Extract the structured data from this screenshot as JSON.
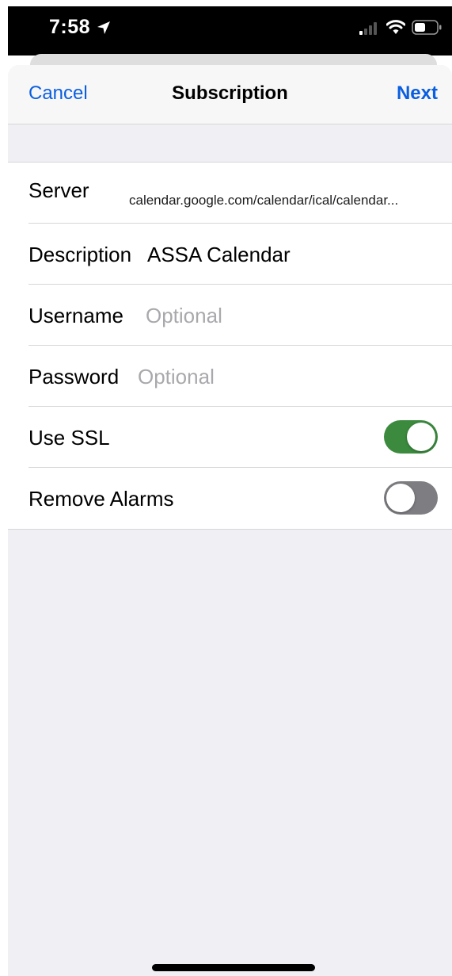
{
  "status_bar": {
    "time": "7:58",
    "icons": [
      "location-arrow-icon",
      "cellular-signal-icon",
      "wifi-icon",
      "battery-icon"
    ]
  },
  "nav": {
    "cancel_label": "Cancel",
    "title": "Subscription",
    "next_label": "Next"
  },
  "form": {
    "server": {
      "label": "Server",
      "value": "calendar.google.com/calendar/ical/calendar..."
    },
    "description": {
      "label": "Description",
      "value": "ASSA Calendar"
    },
    "username": {
      "label": "Username",
      "value": "",
      "placeholder": "Optional"
    },
    "password": {
      "label": "Password",
      "value": "",
      "placeholder": "Optional"
    },
    "use_ssl": {
      "label": "Use SSL",
      "enabled": true
    },
    "remove_alarms": {
      "label": "Remove Alarms",
      "enabled": false
    }
  },
  "colors": {
    "accent": "#0a5fe0",
    "toggle_on": "#3b8a3e",
    "toggle_off": "#7d7d82",
    "grouped_background": "#efeff4"
  }
}
